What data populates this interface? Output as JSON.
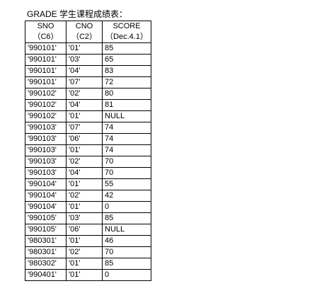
{
  "caption": "GRADE 学生课程成绩表：",
  "table": {
    "header_names": [
      "SNO",
      "CNO",
      "SCORE"
    ],
    "header_types": [
      "（C6）",
      "（C2）",
      "（Dec.4.1）"
    ],
    "rows": [
      [
        "'990101'",
        "'01'",
        "85"
      ],
      [
        "'990101'",
        "'03'",
        "65"
      ],
      [
        "'990101'",
        "'04'",
        "83"
      ],
      [
        "'990101'",
        "'07'",
        "72"
      ],
      [
        "'990102'",
        "'02'",
        "80"
      ],
      [
        "'990102'",
        "'04'",
        "81"
      ],
      [
        "'990102'",
        "'01'",
        "NULL"
      ],
      [
        "'990103'",
        "'07'",
        "74"
      ],
      [
        "'990103'",
        "'06'",
        "74"
      ],
      [
        "'990103'",
        "'01'",
        "74"
      ],
      [
        "'990103'",
        "'02'",
        "70"
      ],
      [
        "'990103'",
        "'04'",
        "70"
      ],
      [
        "'990104'",
        "'01'",
        "55"
      ],
      [
        "'990104'",
        "'02'",
        "42"
      ],
      [
        "'990104'",
        "'01'",
        "0"
      ],
      [
        "'990105'",
        "'03'",
        "85"
      ],
      [
        "'990105'",
        "'06'",
        "NULL"
      ],
      [
        "'980301'",
        "'01'",
        "46"
      ],
      [
        "'980301'",
        "'02'",
        "70"
      ],
      [
        "'980302'",
        "'01'",
        "85"
      ],
      [
        "'990401'",
        "'01'",
        "0"
      ]
    ]
  }
}
